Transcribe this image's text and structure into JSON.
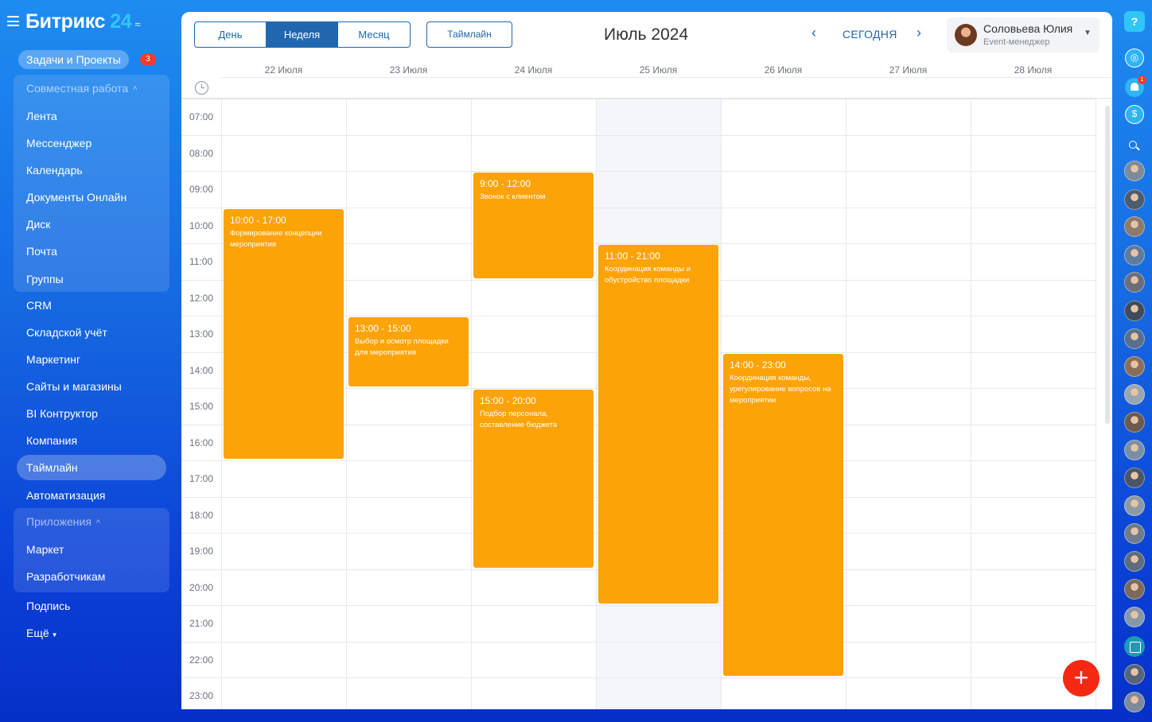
{
  "logo": {
    "name": "Битрикс",
    "num": "24"
  },
  "sidebar": {
    "tasks_label": "Задачи и Проекты",
    "tasks_badge": "3",
    "group1_title": "Совместная работа",
    "group1_items": [
      "Лента",
      "Мессенджер",
      "Календарь",
      "Документы Онлайн",
      "Диск",
      "Почта",
      "Группы"
    ],
    "items": [
      "CRM",
      "Складской учёт",
      "Маркетинг",
      "Сайты и магазины",
      "BI Контруктор",
      "Компания",
      "Таймлайн",
      "Автоматизация"
    ],
    "active_item": "Таймлайн",
    "group2_title": "Приложения",
    "group2_items": [
      "Маркет",
      "Разработчикам"
    ],
    "bottom_items": [
      "Подпись",
      "Ещё"
    ]
  },
  "toolbar": {
    "view_day": "День",
    "view_week": "Неделя",
    "view_month": "Месяц",
    "active_view": "Неделя",
    "timeline_btn": "Таймлайн",
    "month_title": "Июль 2024",
    "today_label": "СЕГОДНЯ"
  },
  "user": {
    "name": "Соловьева Юлия",
    "role": "Event-менеджер"
  },
  "calendar": {
    "days": [
      "22 Июля",
      "23 Июля",
      "24 Июля",
      "25 Июля",
      "26 Июля",
      "27 Июля",
      "28 Июля"
    ],
    "today_index": 3,
    "hours": [
      "07:00",
      "08:00",
      "09:00",
      "10:00",
      "11:00",
      "12:00",
      "13:00",
      "14:00",
      "15:00",
      "16:00",
      "17:00",
      "18:00",
      "19:00",
      "20:00",
      "21:00",
      "22:00",
      "23:00"
    ],
    "event_color": "#fba307",
    "events": [
      {
        "day": 0,
        "start": 10,
        "end": 17,
        "time": "10:00 - 17:00",
        "title": "Формирование концепции мероприятия"
      },
      {
        "day": 1,
        "start": 13,
        "end": 15,
        "time": "13:00 - 15:00",
        "title": "Выбор и осмотр площадки для мероприятия"
      },
      {
        "day": 2,
        "start": 9,
        "end": 12,
        "time": "9:00 - 12:00",
        "title": "Звонок с клиентом"
      },
      {
        "day": 2,
        "start": 15,
        "end": 20,
        "time": "15:00 - 20:00",
        "title": "Подбор персонала, составление бюджета"
      },
      {
        "day": 3,
        "start": 11,
        "end": 21,
        "time": "11:00 - 21:00",
        "title": "Координация команды и обустройство площадки"
      },
      {
        "day": 4,
        "start": 14,
        "end": 23,
        "time": "14:00 - 23:00",
        "title": "Координация команды, урегулирование вопросов на мероприятии"
      }
    ]
  },
  "icons": {
    "menu": "burger-icon",
    "help": "help-icon",
    "globe": "globe-icon",
    "bell": "bell-icon",
    "money": "dollar-icon",
    "search": "search-icon",
    "clock": "clock-icon",
    "add": "plus-icon"
  },
  "rail": {
    "bell_count": "1"
  }
}
